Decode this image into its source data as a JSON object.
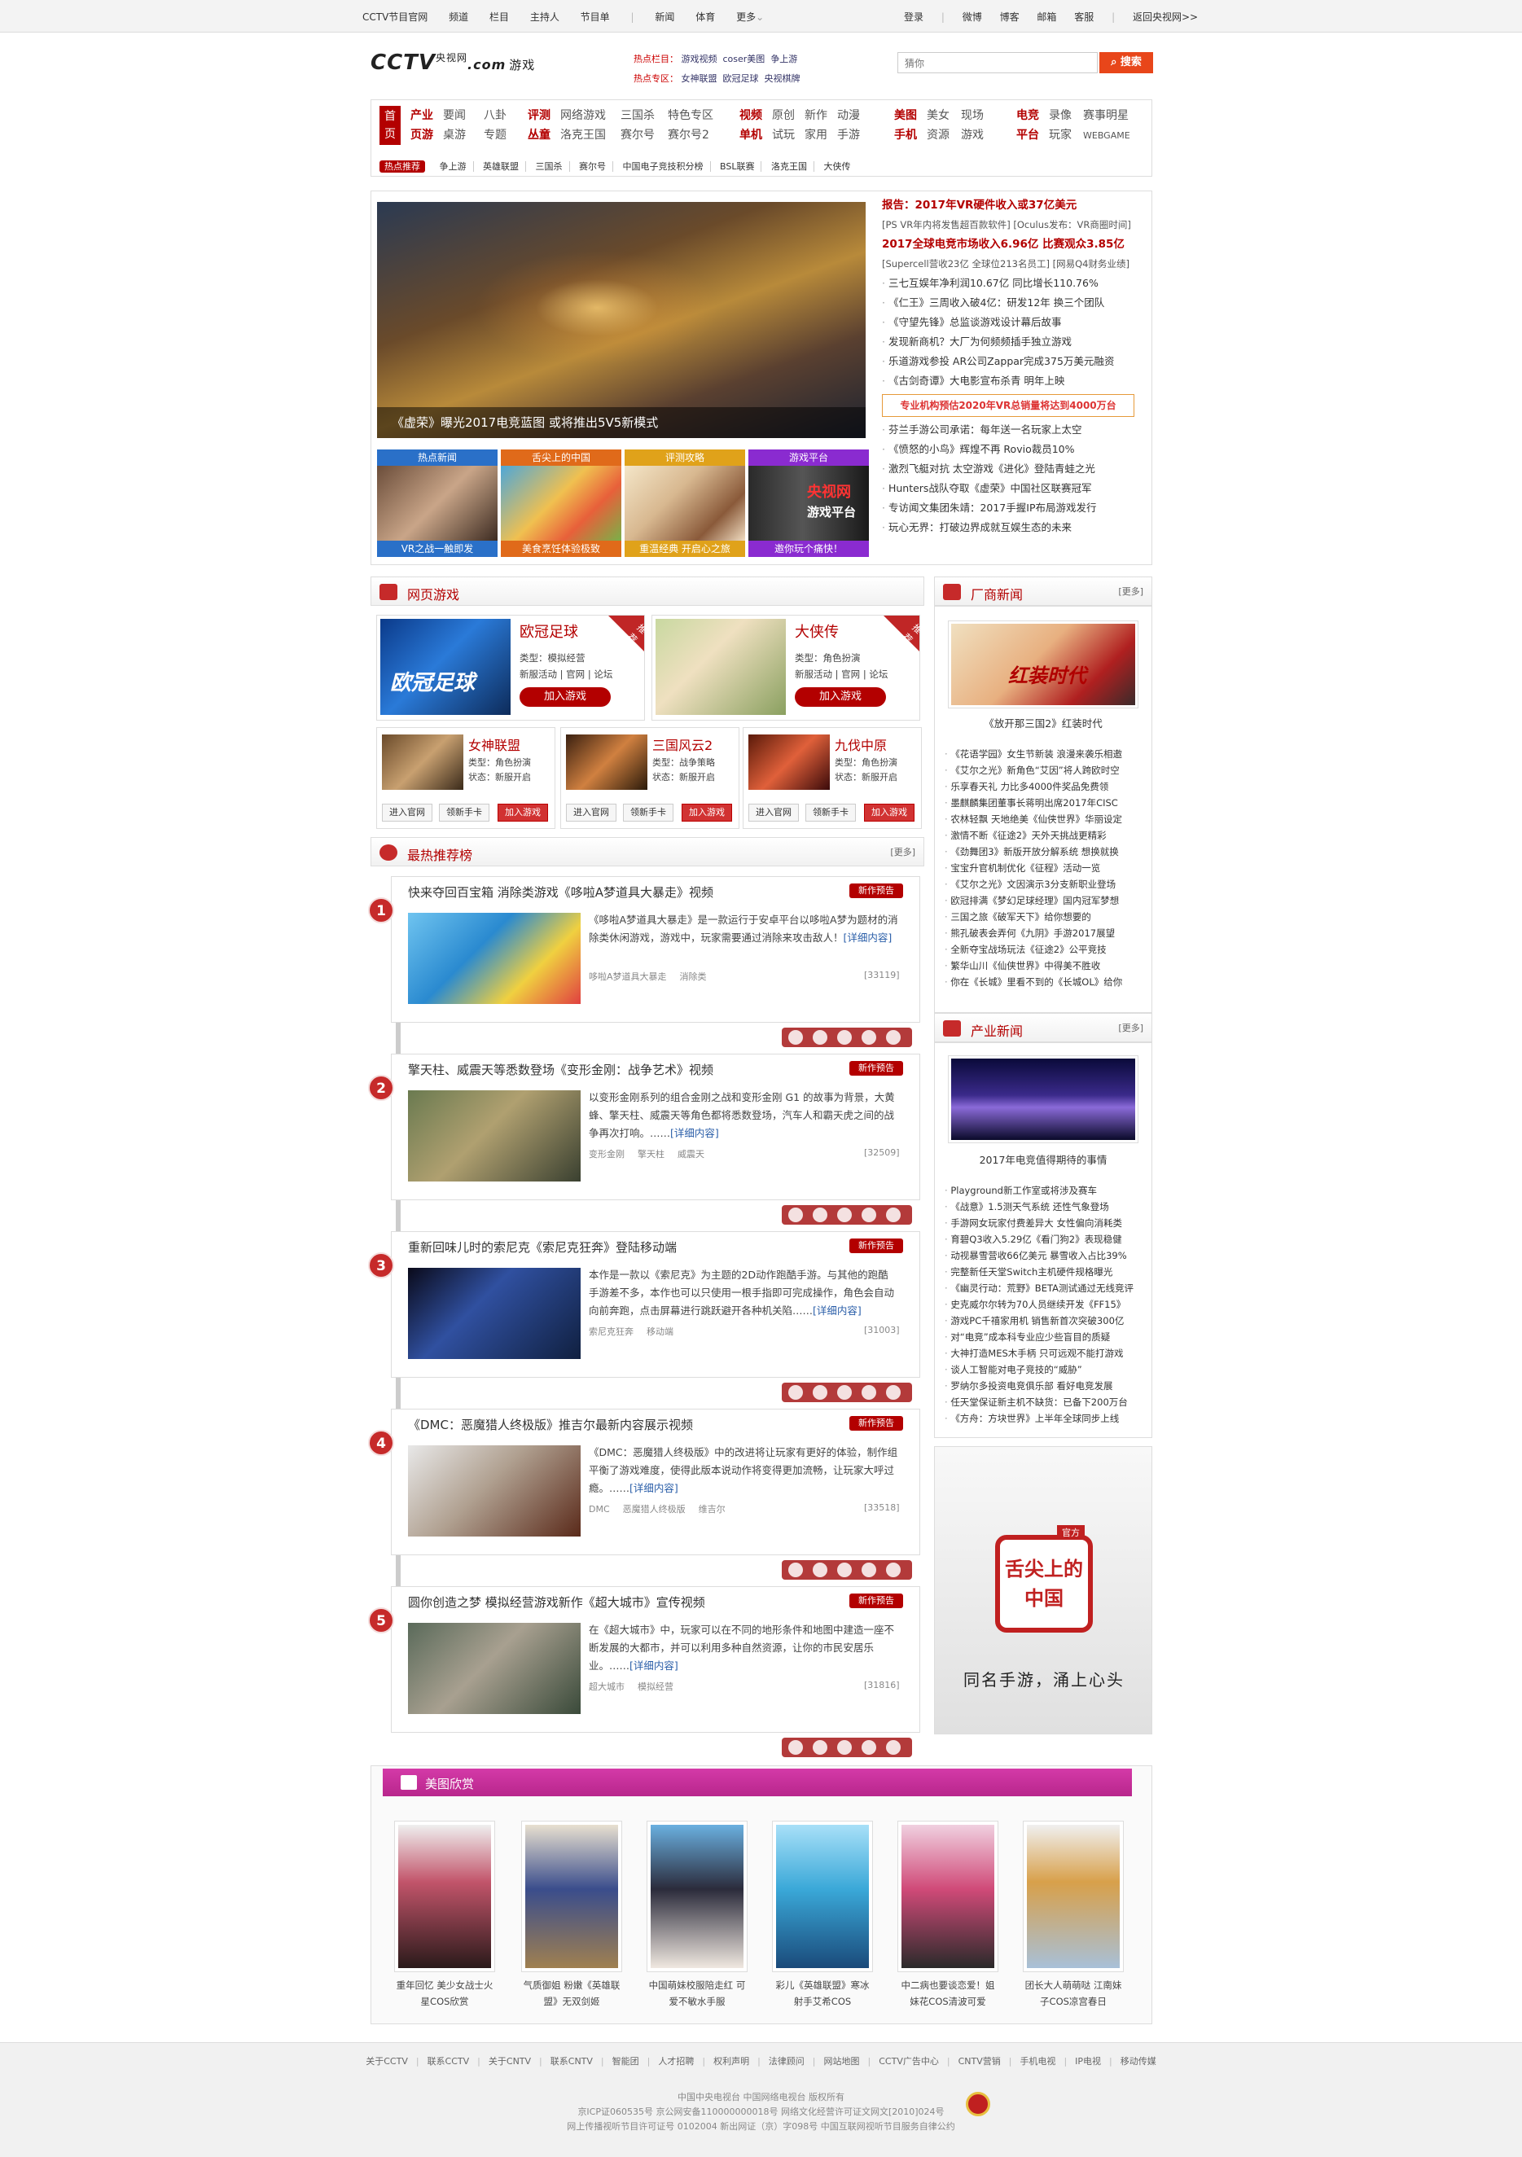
{
  "topbar": {
    "links": [
      "CCTV节目官网",
      "频道",
      "栏目",
      "主持人",
      "节目单",
      "新闻",
      "体育",
      "更多"
    ],
    "right": [
      "登录",
      "微博",
      "博客",
      "邮箱",
      "客服",
      "返回央视网>>"
    ]
  },
  "logo": {
    "brand": "CCTV",
    "small": "央视网",
    "com": ".com",
    "sub": "游戏"
  },
  "hot": {
    "label1": "热点栏目：",
    "items1": [
      "游戏视频",
      "coser美图",
      "争上游"
    ],
    "label2": "热点专区：",
    "items2": [
      "女神联盟",
      "欧冠足球",
      "央视棋牌"
    ]
  },
  "search": {
    "placeholder": "猜你",
    "button": "搜索"
  },
  "nav": {
    "home": [
      "首",
      "页"
    ],
    "g1": {
      "row1": [
        "产业",
        "要闻",
        "八卦"
      ],
      "row2": [
        "页游",
        "桌游",
        "专题"
      ]
    },
    "g2": {
      "row1": [
        "评测",
        "网络游戏",
        "三国杀",
        "特色专区"
      ],
      "row2": [
        "丛童",
        "洛克王国",
        "赛尔号",
        "赛尔号2"
      ]
    },
    "g3": {
      "row1": [
        "视频",
        "原创",
        "新作",
        "动漫"
      ],
      "row2": [
        "单机",
        "试玩",
        "家用",
        "手游"
      ]
    },
    "g4": {
      "row1": [
        "美图",
        "美女",
        "现场"
      ],
      "row2": [
        "手机",
        "资源",
        "游戏"
      ]
    },
    "g5": {
      "row1": [
        "电竞",
        "录像",
        "赛事明星"
      ],
      "row2": [
        "平台",
        "玩家",
        "WEBGAME"
      ]
    },
    "subtag": "热点推荐",
    "sub": [
      "争上游",
      "英雄联盟",
      "三国杀",
      "赛尔号",
      "中国电子竞技积分榜",
      "BSL联赛",
      "洛克王国",
      "大侠传"
    ]
  },
  "focus": {
    "caption": "《虚荣》曝光2017电竞蓝图 或将推出5V5新模式"
  },
  "thumbs": [
    {
      "head": "热点新闻",
      "foot": "VR之战一触即发",
      "color": "#2a70c8"
    },
    {
      "head": "舌尖上的中国",
      "foot": "美食烹饪体验极致",
      "color": "#e06a1a"
    },
    {
      "head": "评测攻略",
      "foot": "重温经典 开启心之旅",
      "color": "#e0a21a"
    },
    {
      "head": "游戏平台",
      "foot": "邀你玩个痛快！",
      "color": "#8a2bd0"
    }
  ],
  "thumbs_mid": {
    "cctv": "央视网",
    "plat": "游戏平台"
  },
  "news": {
    "h1": "报告：2017年VR硬件收入或37亿美元",
    "s1": "[PS VR年内将发售超百款软件] [Oculus发布：VR商圈时间]",
    "h2": "2017全球电竞市场收入6.96亿 比赛观众3.85亿",
    "s2": "[Supercell营收23亿 全球位213名员工] [网易Q4财务业绩]",
    "list1": [
      "三七互娱年净利润10.67亿 同比增长110.76%",
      "《仁王》三周收入破4亿：研发12年 换三个团队",
      "《守望先锋》总监谈游戏设计幕后故事",
      "发现新商机？大厂为何频频插手独立游戏",
      "乐道游戏参投 AR公司Zappar完成375万美元融资",
      "《古剑奇谭》大电影宣布杀青 明年上映"
    ],
    "biz": "专业机构预估2020年VR总销量将达到4000万台",
    "list2": [
      "芬兰手游公司承诺：每年送一名玩家上太空",
      "《愤怒的小鸟》辉煌不再 Rovio裁员10%",
      "激烈飞艇对抗 太空游戏《进化》登陆青蛙之光",
      "Hunters战队夺取《虚荣》中国社区联赛冠军",
      "专访闻文集团朱靖：2017手握IP布局游戏发行",
      "玩心无界：打破边界成就互娱生态的未来"
    ]
  },
  "webgames": {
    "title": "网页游戏",
    "ribbon": "推荐",
    "big": [
      {
        "name": "欧冠足球",
        "type": "类型：模拟经营",
        "links": "新服活动 | 官网 | 论坛",
        "btn": "加入游戏"
      },
      {
        "name": "大侠传",
        "type": "类型：角色扮演",
        "links": "新服活动 | 官网 | 论坛",
        "btn": "加入游戏"
      }
    ],
    "small": [
      {
        "name": "女神联盟",
        "type": "类型：角色扮演",
        "state": "状态：新服开启",
        "b1": "进入官网",
        "b2": "领新手卡",
        "b3": "加入游戏"
      },
      {
        "name": "三国风云2",
        "type": "类型：战争策略",
        "state": "状态：新服开启",
        "b1": "进入官网",
        "b2": "领新手卡",
        "b3": "加入游戏"
      },
      {
        "name": "九伐中原",
        "type": "类型：角色扮演",
        "state": "状态：新服开启",
        "b1": "进入官网",
        "b2": "领新手卡",
        "b3": "加入游戏"
      }
    ]
  },
  "ranking": {
    "title": "最热推荐榜",
    "more": "[更多]",
    "tag": "新作预告",
    "detail": "[详细内容]",
    "items": [
      {
        "n": "1",
        "title": "快来夺回百宝箱 消除类游戏《哆啦A梦道具大暴走》视频",
        "desc": "《哆啦A梦道具大暴走》是一款运行于安卓平台以哆啦A梦为题材的消除类休闲游戏，游戏中，玩家需要通过消除来攻击敌人！",
        "kw": [
          "哆啦A梦道具大暴走",
          "消除类"
        ],
        "cnt": "[33119]"
      },
      {
        "n": "2",
        "title": "擎天柱、威震天等悉数登场《变形金刚：战争艺术》视频",
        "desc": "以变形金刚系列的组合金刚之战和变形金刚 G1 的故事为背景，大黄蜂、擎天柱、威震天等角色都将悉数登场，汽车人和霸天虎之间的战争再次打响。……",
        "kw": [
          "变形金刚",
          "擎天柱",
          "威震天"
        ],
        "cnt": "[32509]"
      },
      {
        "n": "3",
        "title": "重新回味儿时的索尼克《索尼克狂奔》登陆移动端",
        "desc": "本作是一款以《索尼克》为主题的2D动作跑酷手游。与其他的跑酷手游差不多，本作也可以只使用一根手指即可完成操作，角色会自动向前奔跑，点击屏幕进行跳跃避开各种机关陷……",
        "kw": [
          "索尼克狂奔",
          "移动端"
        ],
        "cnt": "[31003]"
      },
      {
        "n": "4",
        "title": "《DMC：恶魔猎人终极版》推吉尔最新内容展示视频",
        "desc": "《DMC：恶魔猎人终极版》中的改进将让玩家有更好的体验，制作组平衡了游戏难度，使得此版本说动作将变得更加流畅，让玩家大呼过瘾。……",
        "kw": [
          "DMC",
          "恶魔猎人终极版",
          "维吉尔"
        ],
        "cnt": "[33518]"
      },
      {
        "n": "5",
        "title": "圆你创造之梦 模拟经营游戏新作《超大城市》宣传视频",
        "desc": "在《超大城市》中，玩家可以在不同的地形条件和地图中建造一座不断发展的大都市，并可以利用多种自然资源，让你的市民安居乐业。……",
        "kw": [
          "超大城市",
          "模拟经营"
        ],
        "cnt": "[31816]"
      }
    ]
  },
  "vendor": {
    "title": "厂商新闻",
    "more": "[更多]",
    "caption": "《放开那三国2》红装时代",
    "img_text": "红装时代",
    "list": [
      "《花语学园》女生节新装 浪漫来袭乐相邀",
      "《艾尔之光》新角色“艾因”将人跨欧时空",
      "乐享春天礼 力比多4000件奖品免费领",
      "墨麒麟集团董事长蒋明出席2017年CISC",
      "农林轻飘 天地绝美《仙侠世界》华丽设定",
      "激情不断《征途2》天外天挑战更精彩",
      "《劲舞团3》新版开放分解系统 想换就换",
      "宝宝升官机制优化《征程》活动一览",
      "《艾尔之光》文因演示3分支新职业登场",
      "欧冠排满《梦幻足球经理》国内冠军梦想",
      "三国之旅《破军天下》给你想要的",
      "熊孔破表会弄何《九阴》手游2017展望",
      "全新夺宝战场玩法《征途2》公平竞技",
      "繁华山川《仙侠世界》中得美不胜收",
      "你在《长城》里看不到的《长城OL》给你"
    ]
  },
  "industry": {
    "title": "产业新闻",
    "more": "[更多]",
    "caption": "2017年电竞值得期待的事情",
    "list": [
      "Playground新工作室或将涉及赛车",
      "《战意》1.5测天气系统 还性气象登场",
      "手游网女玩家付费差异大 女性偏向消耗类",
      "育碧Q3收入5.29亿《看门狗2》表现稳健",
      "动视暴雪营收66亿美元 暴雪收入占比39%",
      "完整新任天堂Switch主机硬件规格曝光",
      "《幽灵行动：荒野》BETA测试通过无线竞评",
      "史克威尔尔转为70人员继续开发《FF15》",
      "游戏PC千禧家用机 销售新首次突破300亿",
      "对“电竞”成本科专业应少些盲目的质疑",
      "大神打造MES木手柄 只可远观不能打游戏",
      "谈人工智能对电子竞技的“威胁”",
      "罗纳尔多投资电竞俱乐部 看好电竞发展",
      "任天堂保证新主机不缺货：已备下200万台",
      "《方舟：方块世界》上半年全球同步上线"
    ]
  },
  "ad": {
    "text": "舌尖上的中国",
    "slogan": "同名手游，涌上心头",
    "badge": "官方"
  },
  "photos": {
    "title": "美图欣赏",
    "items": [
      {
        "c1": "重年回忆 美少女战士火",
        "c2": "星COS欣赏",
        "color": "#c2546a"
      },
      {
        "c1": "气质御姐 粉嫩《英雄联",
        "c2": "盟》无双剑姬",
        "color": "#3a4d8c"
      },
      {
        "c1": "中国萌妹校服陪走红 可",
        "c2": "爱不敏水手服",
        "color": "#2b2b3b"
      },
      {
        "c1": "彩儿《英雄联盟》寒冰",
        "c2": "射手艾希COS",
        "color": "#3aa8d8"
      },
      {
        "c1": "中二病也要谈恋爱！姐",
        "c2": "妹花COS清波可爱",
        "color": "#d04a78"
      },
      {
        "c1": "团长大人萌萌哒 江南妹",
        "c2": "子COS凉宫春日",
        "color": "#d8a04a"
      }
    ]
  },
  "footer": {
    "links": [
      "关于CCTV",
      "联系CCTV",
      "关于CNTV",
      "联系CNTV",
      "智能团",
      "人才招聘",
      "权利声明",
      "法律顾问",
      "网站地图",
      "CCTV广告中心",
      "CNTV营销",
      "手机电视",
      "IP电视",
      "移动传媒"
    ],
    "l2": "中国中央电视台    中国网络电视台    版权所有",
    "l3": "京ICP证060535号    京公网安备110000000018号    网络文化经营许可证文网文[2010]024号",
    "l4": "网上传播视听节目许可证号 0102004    新出网证（京）字098号    中国互联网视听节目服务自律公约"
  }
}
